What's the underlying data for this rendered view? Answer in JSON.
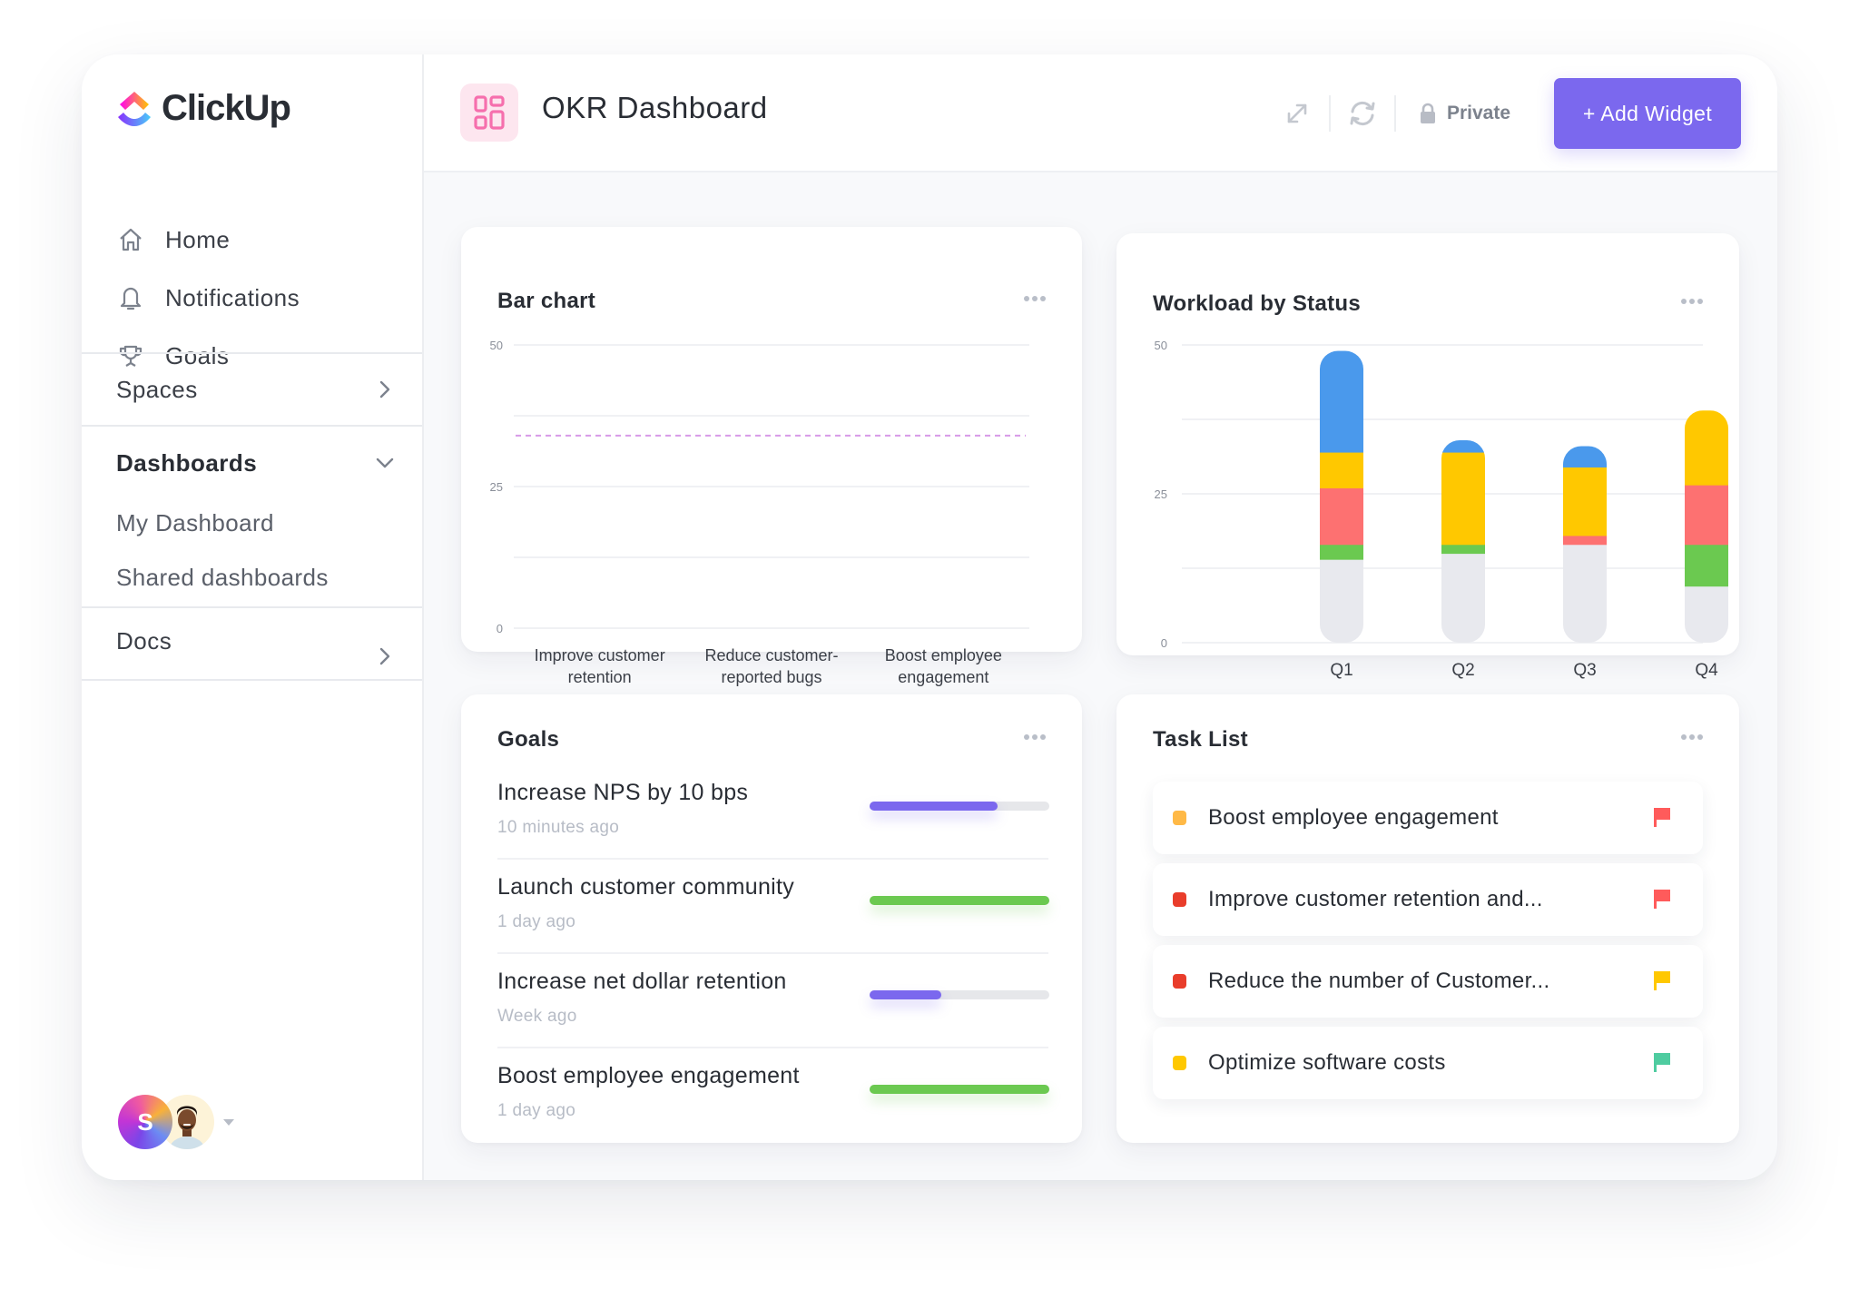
{
  "app": {
    "brand": "ClickUp"
  },
  "sidebar": {
    "nav": [
      {
        "label": "Home",
        "icon": "home-icon"
      },
      {
        "label": "Notifications",
        "icon": "bell-icon"
      },
      {
        "label": "Goals",
        "icon": "trophy-icon"
      }
    ],
    "spaces": {
      "label": "Spaces",
      "state": "collapsed"
    },
    "dashboards": {
      "label": "Dashboards",
      "state": "expanded",
      "items": [
        {
          "label": "My Dashboard"
        },
        {
          "label": "Shared dashboards"
        }
      ]
    },
    "docs": {
      "label": "Docs",
      "state": "collapsed"
    },
    "user": {
      "avatar_initial": "S"
    }
  },
  "header": {
    "title": "OKR Dashboard",
    "privacy_label": "Private",
    "add_widget_label": "+ Add Widget"
  },
  "widgets": {
    "bar_chart": {
      "title": "Bar chart"
    },
    "workload": {
      "title": "Workload by Status"
    },
    "goals": {
      "title": "Goals",
      "items": [
        {
          "name": "Increase NPS by 10 bps",
          "time": "10 minutes ago",
          "progress": 0.71,
          "color": "#7b68ee"
        },
        {
          "name": "Launch customer community",
          "time": "1 day ago",
          "progress": 1.0,
          "color": "#6bc950"
        },
        {
          "name": "Increase net dollar retention",
          "time": "Week ago",
          "progress": 0.4,
          "color": "#7b68ee"
        },
        {
          "name": "Boost employee engagement",
          "time": "1 day ago",
          "progress": 1.0,
          "color": "#6bc950"
        }
      ]
    },
    "tasks": {
      "title": "Task List",
      "items": [
        {
          "name": "Boost employee engagement",
          "status_color": "#ffb946",
          "flag_color": "#ff5b5b",
          "priority": "urgent"
        },
        {
          "name": "Improve customer retention and...",
          "status_color": "#e93d2b",
          "flag_color": "#ff5b5b",
          "priority": "urgent"
        },
        {
          "name": "Reduce the number of Customer...",
          "status_color": "#e93d2b",
          "flag_color": "#ffc800",
          "priority": "high"
        },
        {
          "name": "Optimize software costs",
          "status_color": "#ffc800",
          "flag_color": "#4fcca0",
          "priority": "normal"
        }
      ]
    }
  },
  "chart_data": [
    {
      "type": "bar",
      "title": "Bar chart",
      "categories": [
        "Improve customer retention",
        "Reduce customer-reported bugs",
        "Boost employee engagement"
      ],
      "category_lines": [
        [
          "Improve customer",
          "retention"
        ],
        [
          "Reduce customer-",
          "reported bugs"
        ],
        [
          "Boost employee",
          "engagement"
        ]
      ],
      "values": [
        null,
        null,
        null
      ],
      "target_line": {
        "value": 34,
        "style": "dashed",
        "color": "#d79ae8"
      },
      "yticks": [
        0,
        25,
        50
      ],
      "ylim": [
        0,
        50
      ],
      "grid": true,
      "xlabel": "",
      "ylabel": ""
    },
    {
      "type": "bar",
      "stacked": true,
      "title": "Workload by Status",
      "categories": [
        "Q1",
        "Q2",
        "Q3",
        "Q4"
      ],
      "series": [
        {
          "name": "gray",
          "color": "#e8e9ee",
          "values": [
            14,
            15,
            16.5,
            9.5
          ]
        },
        {
          "name": "green",
          "color": "#6bc950",
          "values": [
            2.5,
            1.5,
            0,
            7
          ]
        },
        {
          "name": "red",
          "color": "#fd7171",
          "values": [
            9.5,
            0,
            1.5,
            10
          ]
        },
        {
          "name": "yellow",
          "color": "#ffc800",
          "values": [
            6,
            15.5,
            11.5,
            12.5
          ]
        },
        {
          "name": "blue",
          "color": "#4a99ec",
          "values": [
            17,
            2,
            3.5,
            0
          ]
        }
      ],
      "yticks": [
        0,
        25,
        50
      ],
      "ylim": [
        0,
        50
      ],
      "grid": true,
      "xlabel": "",
      "ylabel": ""
    }
  ]
}
